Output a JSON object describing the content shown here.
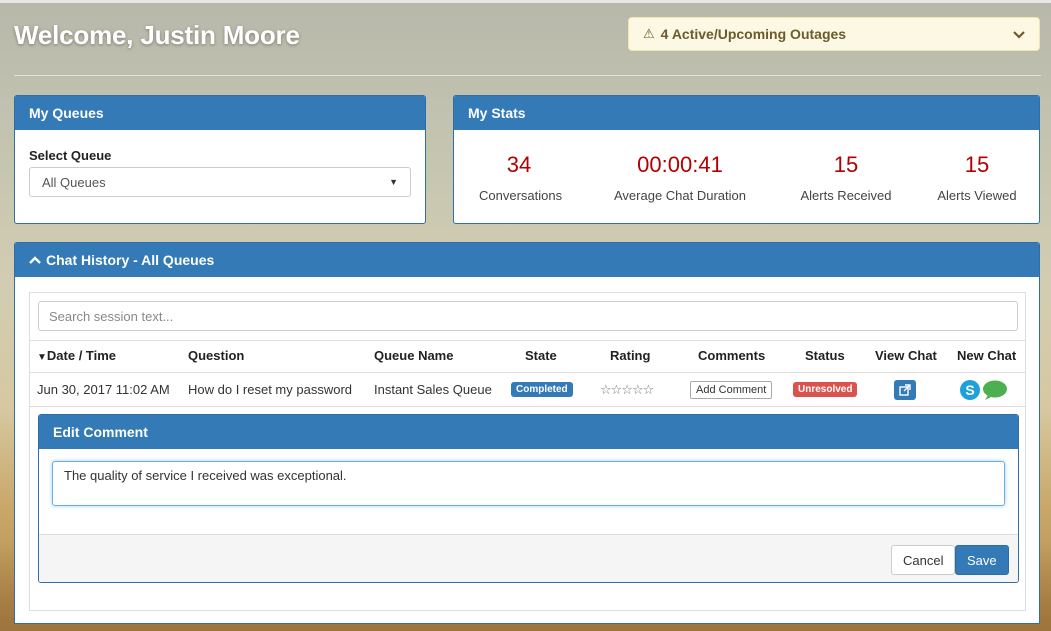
{
  "header": {
    "welcome": "Welcome, Justin Moore",
    "outage_label": "4 Active/Upcoming Outages"
  },
  "queues": {
    "title": "My Queues",
    "select_label": "Select Queue",
    "selected": "All Queues"
  },
  "stats": {
    "title": "My Stats",
    "items": [
      {
        "value": "34",
        "label": "Conversations"
      },
      {
        "value": "00:00:41",
        "label": "Average Chat Duration"
      },
      {
        "value": "15",
        "label": "Alerts Received"
      },
      {
        "value": "15",
        "label": "Alerts Viewed"
      }
    ]
  },
  "history": {
    "title": "Chat History - All Queues",
    "search_placeholder": "Search session text...",
    "columns": [
      "Date / Time",
      "Question",
      "Queue Name",
      "State",
      "Rating",
      "Comments",
      "Status",
      "View Chat",
      "New Chat"
    ],
    "rows": [
      {
        "date": "Jun 30, 2017 11:02 AM",
        "question": "How do I reset my password",
        "queue": "Instant Sales Queue",
        "state": "Completed",
        "rating": "☆☆☆☆☆",
        "comment_button": "Add Comment",
        "status": "Unresolved"
      }
    ]
  },
  "edit_comment": {
    "title": "Edit Comment",
    "text": "The quality of service I received was exceptional.",
    "cancel": "Cancel",
    "save": "Save"
  },
  "colors": {
    "primary": "#337ab7",
    "stat_value": "#b30000",
    "danger": "#d9534f",
    "warning_bg": "#fcf8e3"
  }
}
